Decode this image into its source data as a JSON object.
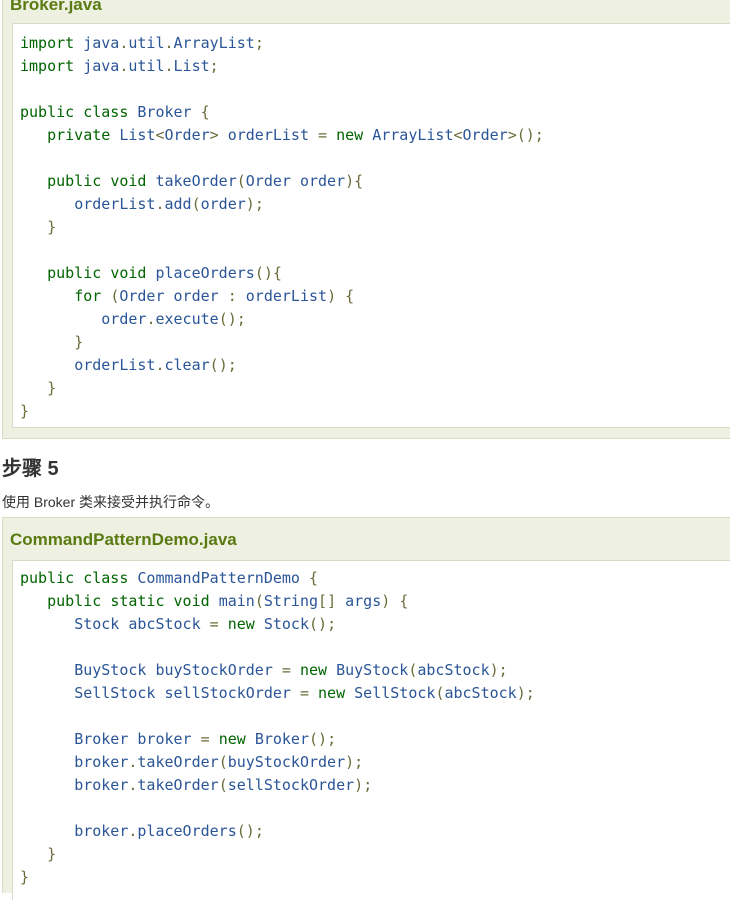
{
  "broker_file": {
    "title": "Broker.java",
    "lines": [
      "import java.util.ArrayList;",
      "import java.util.List;",
      "",
      "public class Broker {",
      "   private List<Order> orderList = new ArrayList<Order>();",
      "",
      "   public void takeOrder(Order order){",
      "      orderList.add(order);",
      "   }",
      "",
      "   public void placeOrders(){",
      "      for (Order order : orderList) {",
      "         order.execute();",
      "      }",
      "      orderList.clear();",
      "   }",
      "}"
    ]
  },
  "step": {
    "heading": "步骤 5",
    "description": "使用 Broker 类来接受并执行命令。"
  },
  "demo_file": {
    "title": "CommandPatternDemo.java",
    "lines": [
      "public class CommandPatternDemo {",
      "   public static void main(String[] args) {",
      "      Stock abcStock = new Stock();",
      "",
      "      BuyStock buyStockOrder = new BuyStock(abcStock);",
      "      SellStock sellStockOrder = new SellStock(abcStock);",
      "",
      "      Broker broker = new Broker();",
      "      broker.takeOrder(buyStockOrder);",
      "      broker.takeOrder(sellStockOrder);",
      "",
      "      broker.placeOrders();",
      "   }",
      "}"
    ]
  },
  "colors": {
    "keyword": "#006400",
    "identifier": "#2a5597",
    "punctuation": "#6b6b3a",
    "title": "#5a7a12"
  }
}
